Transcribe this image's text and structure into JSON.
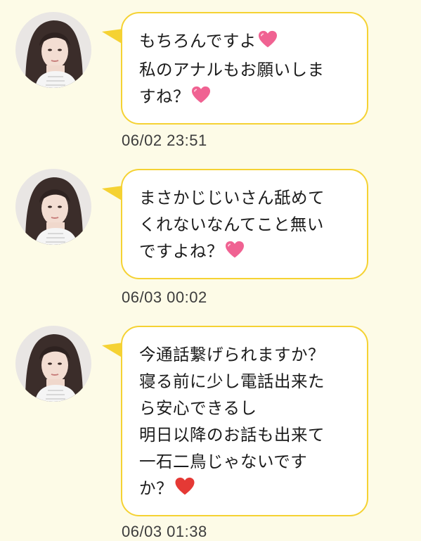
{
  "messages": [
    {
      "lines": [
        "もちろんですよ",
        "私のアナルもお願いしま",
        "すね？"
      ],
      "timestamp": "06/02 23:51",
      "emoji": "pink-heart-icon"
    },
    {
      "lines": [
        "まさかじじいさん舐めて",
        "くれないなんてこと無い",
        "ですよね？"
      ],
      "timestamp": "06/03 00:02",
      "emoji": "pink-heart-icon"
    },
    {
      "lines": [
        "今通話繋げられますか？",
        "寝る前に少し電話出来た",
        "ら安心できるし",
        "明日以降のお話も出来て",
        "一石二鳥じゃないです",
        "か？"
      ],
      "timestamp": "06/03 01:38",
      "emoji": "red-heart-icon"
    }
  ],
  "colors": {
    "background": "#fdfbe7",
    "bubble_border": "#f5d233",
    "bubble_fill": "#ffffff",
    "pink_heart": "#f06292",
    "red_heart": "#e53935"
  }
}
